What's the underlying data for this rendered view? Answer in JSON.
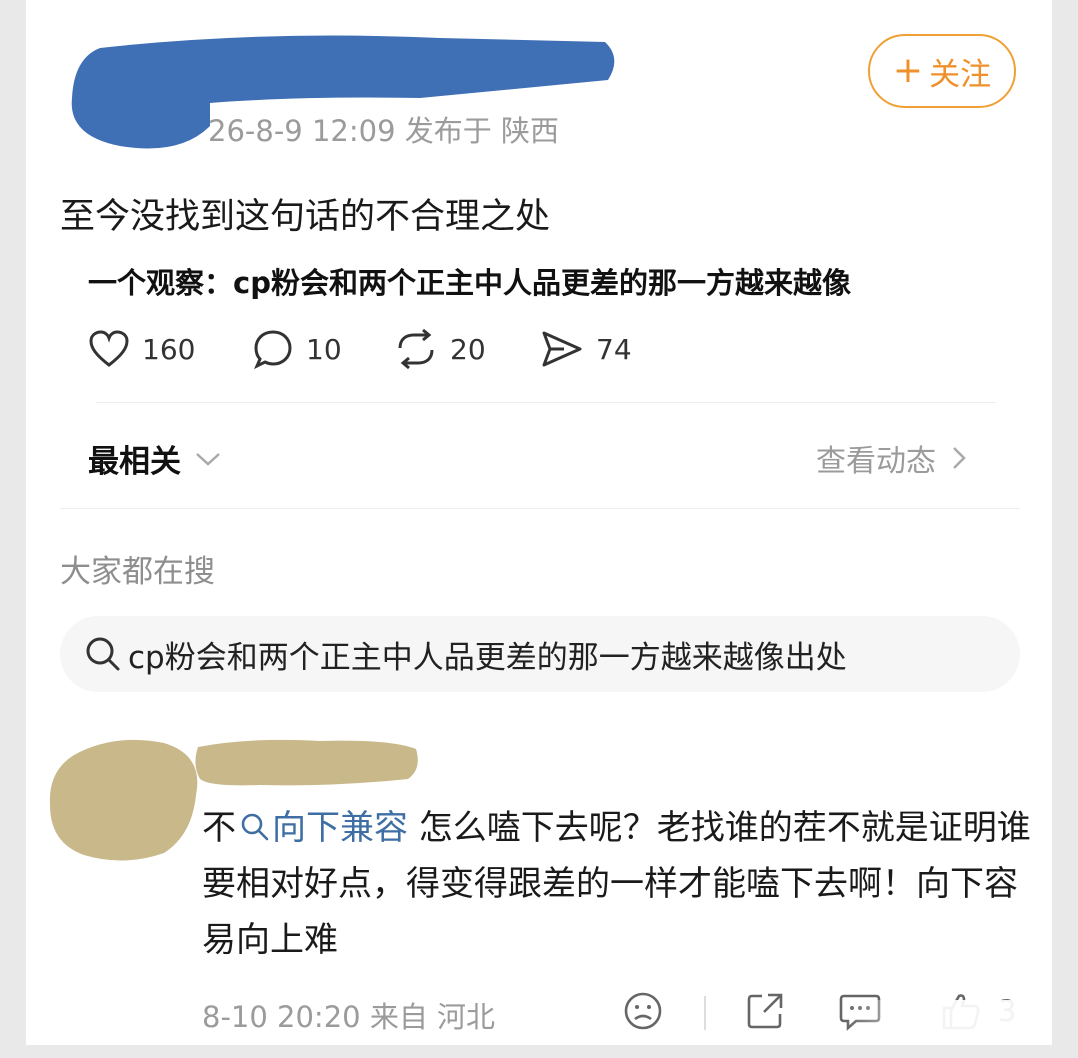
{
  "post": {
    "meta": "26-8-9 12:09  发布于 陕西",
    "follow_label": "关注",
    "follow_plus": "+",
    "text": "至今没找到这句话的不合理之处",
    "quote": "一个观察：cp粉会和两个正主中人品更差的那一方越来越像"
  },
  "actions": {
    "likes": "160",
    "comments": "10",
    "reposts": "20",
    "shares": "74"
  },
  "sort": {
    "label": "最相关",
    "view_label": "查看动态"
  },
  "search_section": {
    "title": "大家都在搜",
    "query": "cp粉会和两个正主中人品更差的那一方越来越像出处"
  },
  "comment": {
    "text_before": "不",
    "link_text": "向下兼容",
    "text_after": " 怎么嗑下去呢？老找谁的茬不就是证明谁要相对好点，得变得跟差的一样才能嗑下去啊！向下容易向上难",
    "meta": "8-10 20:20  来自 河北",
    "like_count": "3"
  },
  "colors": {
    "accent": "#f0902a",
    "link": "#3e6ea3",
    "muted": "#9b9b9b",
    "redaction_blue": "#3f6fb5",
    "redaction_tan": "#c8b88a"
  },
  "icons": [
    "heart-icon",
    "comment-bubble-icon",
    "repost-icon",
    "share-icon",
    "chevron-down-icon",
    "chevron-right-icon",
    "search-icon",
    "sad-face-icon",
    "share-box-icon",
    "chat-icon",
    "thumbs-up-icon"
  ]
}
